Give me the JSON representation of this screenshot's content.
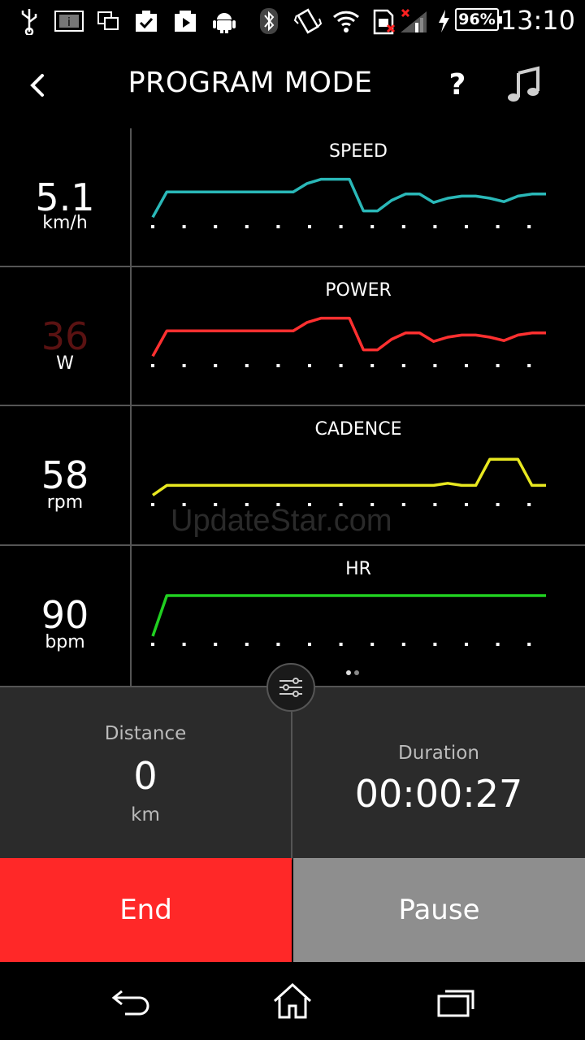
{
  "status_bar": {
    "battery_percent": "96%",
    "time": "13:10",
    "icons": [
      "usb-icon",
      "info-icon",
      "screen-icon",
      "tasks-icon",
      "media-icon",
      "android-icon",
      "bluetooth-icon",
      "vibrate-icon",
      "wifi-icon",
      "sim-icon",
      "signal-icon",
      "charging-icon",
      "battery-icon"
    ]
  },
  "app_bar": {
    "title": "PROGRAM MODE",
    "help_label": "?",
    "icons": [
      "back-icon",
      "music-icon"
    ]
  },
  "metrics": [
    {
      "value": "5.1",
      "unit": "km/h",
      "graph_title": "SPEED",
      "color": "#2ab8b8",
      "series": [
        0.05,
        0.65,
        0.65,
        0.65,
        0.65,
        0.65,
        0.65,
        0.65,
        0.65,
        0.65,
        0.65,
        0.85,
        0.95,
        0.95,
        0.95,
        0.2,
        0.2,
        0.45,
        0.6,
        0.6,
        0.4,
        0.5,
        0.55,
        0.55,
        0.5,
        0.42,
        0.55,
        0.6,
        0.6
      ]
    },
    {
      "value": "36",
      "unit": "W",
      "graph_title": "POWER",
      "color": "#ff3030",
      "value_color": "#5a1212",
      "series": [
        0.05,
        0.65,
        0.65,
        0.65,
        0.65,
        0.65,
        0.65,
        0.65,
        0.65,
        0.65,
        0.65,
        0.85,
        0.95,
        0.95,
        0.95,
        0.2,
        0.2,
        0.45,
        0.6,
        0.6,
        0.4,
        0.5,
        0.55,
        0.55,
        0.5,
        0.42,
        0.55,
        0.6,
        0.6
      ]
    },
    {
      "value": "58",
      "unit": "rpm",
      "graph_title": "CADENCE",
      "color": "#e8e820",
      "series": [
        0.05,
        0.28,
        0.28,
        0.28,
        0.28,
        0.28,
        0.28,
        0.28,
        0.28,
        0.28,
        0.28,
        0.28,
        0.28,
        0.28,
        0.28,
        0.28,
        0.28,
        0.28,
        0.28,
        0.28,
        0.28,
        0.33,
        0.28,
        0.28,
        0.9,
        0.9,
        0.9,
        0.28,
        0.28
      ]
    },
    {
      "value": "90",
      "unit": "bpm",
      "graph_title": "HR",
      "color": "#20d020",
      "series": [
        0.02,
        0.98,
        0.98,
        0.98,
        0.98,
        0.98,
        0.98,
        0.98,
        0.98,
        0.98,
        0.98,
        0.98,
        0.98,
        0.98,
        0.98,
        0.98,
        0.98,
        0.98,
        0.98,
        0.98,
        0.98,
        0.98,
        0.98,
        0.98,
        0.98,
        0.98,
        0.98,
        0.98,
        0.98
      ]
    }
  ],
  "pager": {
    "pages": 2,
    "active": 0
  },
  "summary": {
    "distance_label": "Distance",
    "distance_value": "0",
    "distance_unit": "km",
    "duration_label": "Duration",
    "duration_value": "00:00:27"
  },
  "actions": {
    "end_label": "End",
    "pause_label": "Pause"
  },
  "watermark": "UpdateStar.com",
  "nav": {
    "icons": [
      "nav-back-icon",
      "nav-home-icon",
      "nav-recents-icon"
    ]
  }
}
